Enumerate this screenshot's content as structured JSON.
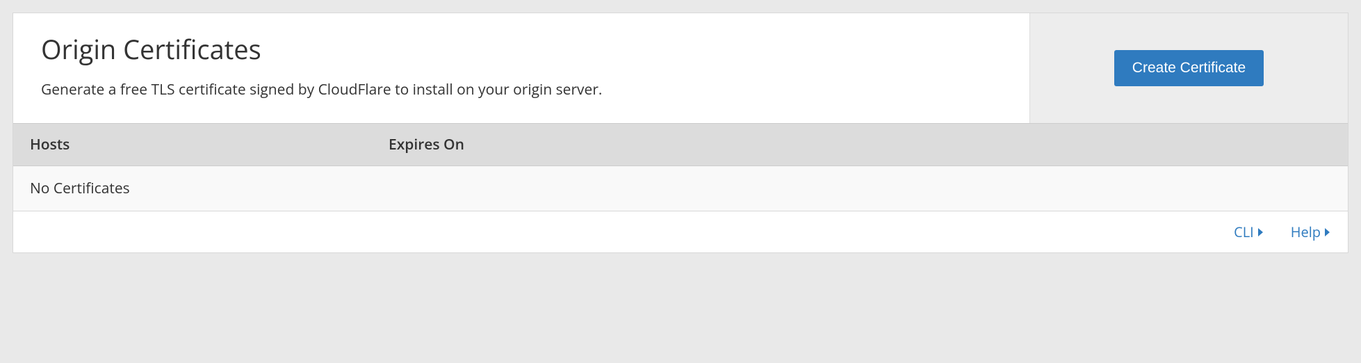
{
  "header": {
    "title": "Origin Certificates",
    "subtitle": "Generate a free TLS certificate signed by CloudFlare to install on your origin server.",
    "create_button": "Create Certificate"
  },
  "table": {
    "columns": {
      "hosts": "Hosts",
      "expires": "Expires On"
    },
    "empty_message": "No Certificates"
  },
  "footer": {
    "cli": "CLI",
    "help": "Help"
  }
}
